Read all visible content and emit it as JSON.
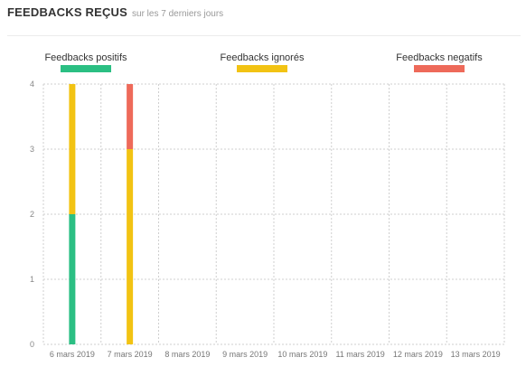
{
  "header": {
    "title": "FEEDBACKS REÇUS",
    "subtitle": "sur les 7 derniers jours"
  },
  "chart_data": {
    "type": "bar",
    "stacked": true,
    "categories": [
      "6 mars 2019",
      "7 mars 2019",
      "8 mars 2019",
      "9 mars 2019",
      "10 mars 2019",
      "11 mars 2019",
      "12 mars 2019",
      "13 mars 2019"
    ],
    "series": [
      {
        "name": "Feedbacks positifs",
        "color": "#2bbf83",
        "values": [
          2,
          0,
          0,
          0,
          0,
          0,
          0,
          0
        ]
      },
      {
        "name": "Feedbacks ignorés",
        "color": "#f2c313",
        "values": [
          2,
          3,
          0,
          0,
          0,
          0,
          0,
          0
        ]
      },
      {
        "name": "Feedbacks negatifs",
        "color": "#ee6a5a",
        "values": [
          0,
          1,
          0,
          0,
          0,
          0,
          0,
          0
        ]
      }
    ],
    "yticks": [
      0,
      1,
      2,
      3,
      4
    ],
    "ylim": [
      0,
      4
    ],
    "grid": true,
    "legend_position": "top"
  }
}
